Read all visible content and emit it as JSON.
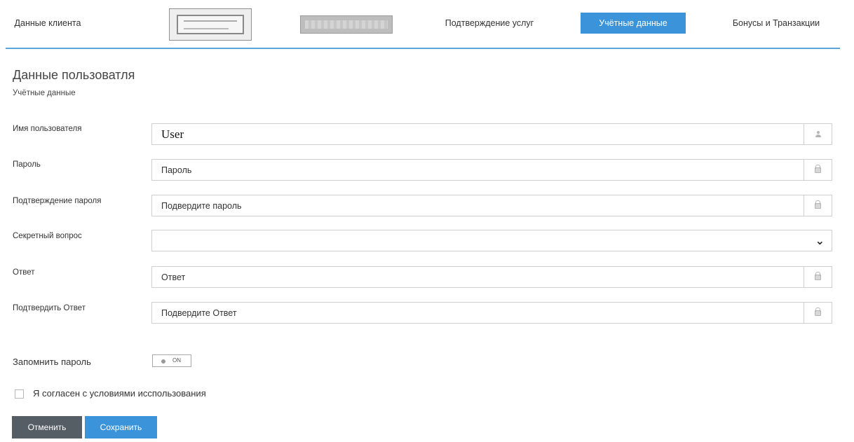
{
  "tabs": [
    {
      "label": "Данные клиента"
    },
    {
      "label": "Подтверждение услуг"
    },
    {
      "label": "Учётные данные"
    },
    {
      "label": "Бонусы и Транзакции"
    }
  ],
  "header": {
    "title": "Данные пользоватля",
    "subtitle": "Учётные данные"
  },
  "form": {
    "username": {
      "label": "Имя пользователя",
      "value": "User",
      "icon": "user-icon"
    },
    "password": {
      "label": "Пароль",
      "placeholder": "Пароль",
      "icon": "lock-icon"
    },
    "password_confirm": {
      "label": "Подтверждение пароля",
      "placeholder": "Подвердите пароль",
      "icon": "lock-icon"
    },
    "secret_question": {
      "label": "Секретный вопрос",
      "value": "",
      "icon": "chevron-down-icon"
    },
    "answer": {
      "label": "Ответ",
      "placeholder": "Ответ",
      "icon": "lock-icon"
    },
    "answer_confirm": {
      "label": "Подтвердить Ответ",
      "placeholder": "Подвердите Ответ",
      "icon": "lock-icon"
    }
  },
  "remember": {
    "label": "Запомнить пароль",
    "toggle_text": "ON"
  },
  "agree": {
    "label": "Я согласен с условиями исспользования",
    "checked": false
  },
  "buttons": {
    "cancel": "Отменить",
    "save": "Сохранить"
  },
  "colors": {
    "accent": "#3b94d9",
    "cancel_button": "#555d65",
    "tab_underline": "#5aa5de"
  }
}
